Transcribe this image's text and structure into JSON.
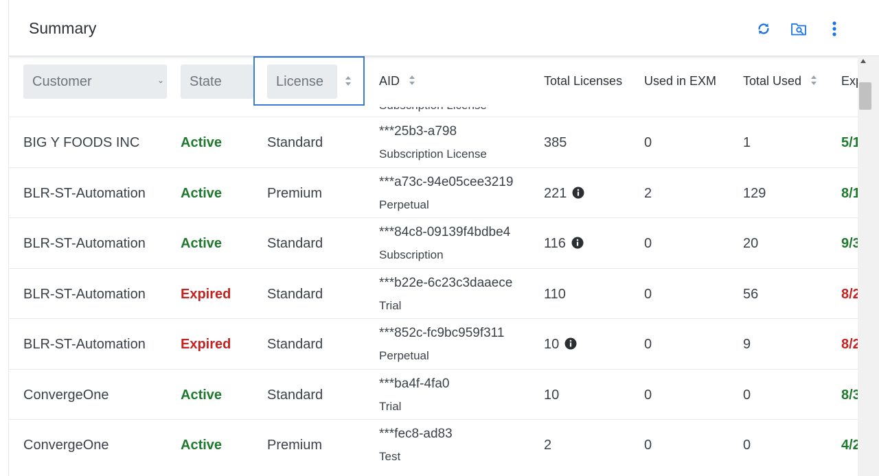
{
  "header": {
    "title": "Summary",
    "icons": [
      "refresh-icon",
      "folder-search-icon",
      "more-vertical-icon"
    ]
  },
  "filters": {
    "customer": "Customer",
    "state": "State",
    "license": "License"
  },
  "columns": {
    "aid": "AID",
    "total_licenses": "Total Licenses",
    "used_in_exm": "Used in EXM",
    "total_used": "Total Used",
    "expiry_partial": "Exp"
  },
  "partial_row_text": "Subscription License",
  "rows": [
    {
      "customer": "BIG Y FOODS INC",
      "state": "Active",
      "license": "Standard",
      "aid": "***25b3-a798",
      "aid_type": "Subscription License",
      "total_licenses": "385",
      "info": false,
      "used_in_exm": "0",
      "total_used": "1",
      "expiry": "5/1"
    },
    {
      "customer": "BLR-ST-Automation",
      "state": "Active",
      "license": "Premium",
      "aid": "***a73c-94e05cee3219",
      "aid_type": "Perpetual",
      "total_licenses": "221",
      "info": true,
      "used_in_exm": "2",
      "total_used": "129",
      "expiry": "8/1"
    },
    {
      "customer": "BLR-ST-Automation",
      "state": "Active",
      "license": "Standard",
      "aid": "***84c8-09139f4bdbe4",
      "aid_type": "Subscription",
      "total_licenses": "116",
      "info": true,
      "used_in_exm": "0",
      "total_used": "20",
      "expiry": "9/3"
    },
    {
      "customer": "BLR-ST-Automation",
      "state": "Expired",
      "license": "Standard",
      "aid": "***b22e-6c23c3daaece",
      "aid_type": "Trial",
      "total_licenses": "110",
      "info": false,
      "used_in_exm": "0",
      "total_used": "56",
      "expiry": "8/2"
    },
    {
      "customer": "BLR-ST-Automation",
      "state": "Expired",
      "license": "Standard",
      "aid": "***852c-fc9bc959f311",
      "aid_type": "Perpetual",
      "total_licenses": "10",
      "info": true,
      "used_in_exm": "0",
      "total_used": "9",
      "expiry": "8/2"
    },
    {
      "customer": "ConvergeOne",
      "state": "Active",
      "license": "Standard",
      "aid": "***ba4f-4fa0",
      "aid_type": "Trial",
      "total_licenses": "10",
      "info": false,
      "used_in_exm": "0",
      "total_used": "0",
      "expiry": "8/3"
    },
    {
      "customer": "ConvergeOne",
      "state": "Active",
      "license": "Premium",
      "aid": "***fec8-ad83",
      "aid_type": "Test",
      "total_licenses": "2",
      "info": false,
      "used_in_exm": "0",
      "total_used": "0",
      "expiry": "4/2"
    }
  ],
  "colors": {
    "active": "#1d7a2d",
    "expired": "#c5221f",
    "accent": "#1a73e8"
  }
}
